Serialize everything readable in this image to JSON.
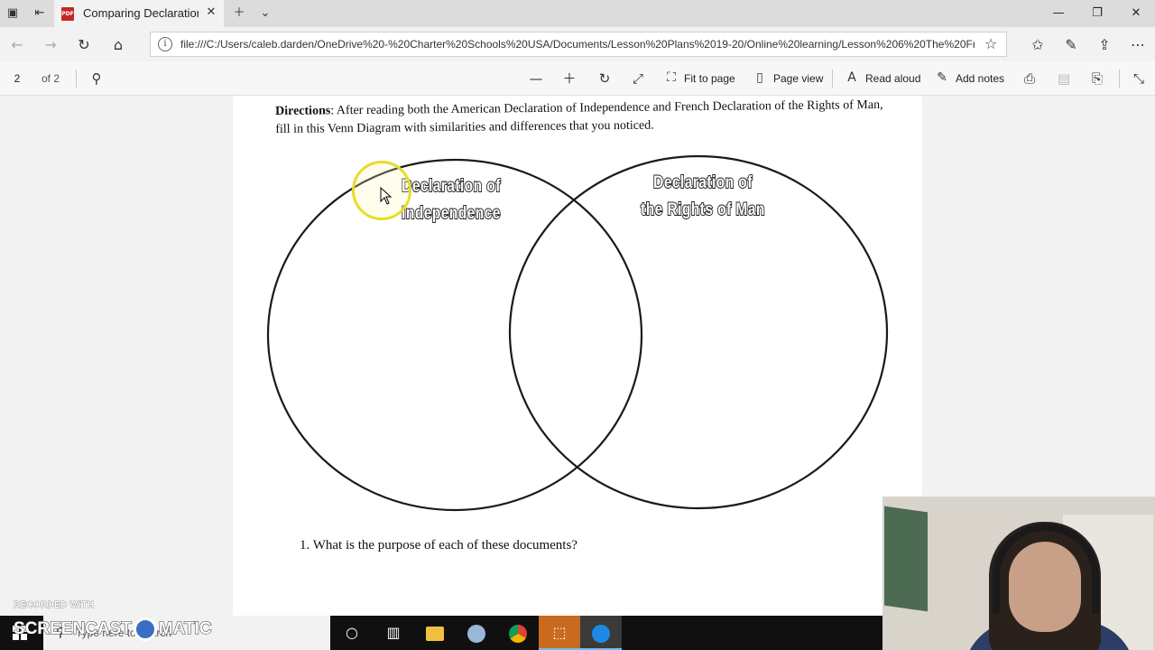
{
  "browser": {
    "tab_title": "Comparing Declaration:",
    "url": "file:///C:/Users/caleb.darden/OneDrive%20-%20Charter%20Schools%20USA/Documents/Lesson%20Plans%2019-20/Online%20learning/Lesson%206%20The%20Fre",
    "favicon": "PDF"
  },
  "pdf_toolbar": {
    "page_number": "2",
    "page_total": "of 2",
    "fit_to_page": "Fit to page",
    "page_view": "Page view",
    "read_aloud": "Read aloud",
    "add_notes": "Add notes"
  },
  "document": {
    "directions_label": "Directions",
    "directions_text": ": After reading both the American Declaration of Independence and French Declaration of the Rights of Man, fill in this Venn Diagram with similarities and differences that you noticed.",
    "venn": {
      "left_title_line1": "Declaration of",
      "left_title_line2": "Independence",
      "right_title_line1": "Declaration of",
      "right_title_line2": "the Rights of Man"
    },
    "question_1": "1.  What is the purpose of each of these documents?"
  },
  "taskbar": {
    "search_placeholder": "Type here to search"
  },
  "watermark": {
    "recorded_with": "RECORDED WITH",
    "brand_left": "SCREENCAST",
    "brand_right": "MATIC"
  },
  "colors": {
    "cursor_highlight": "#e8dc2a",
    "pdf_icon": "#c62828",
    "taskbar": "#101010"
  }
}
